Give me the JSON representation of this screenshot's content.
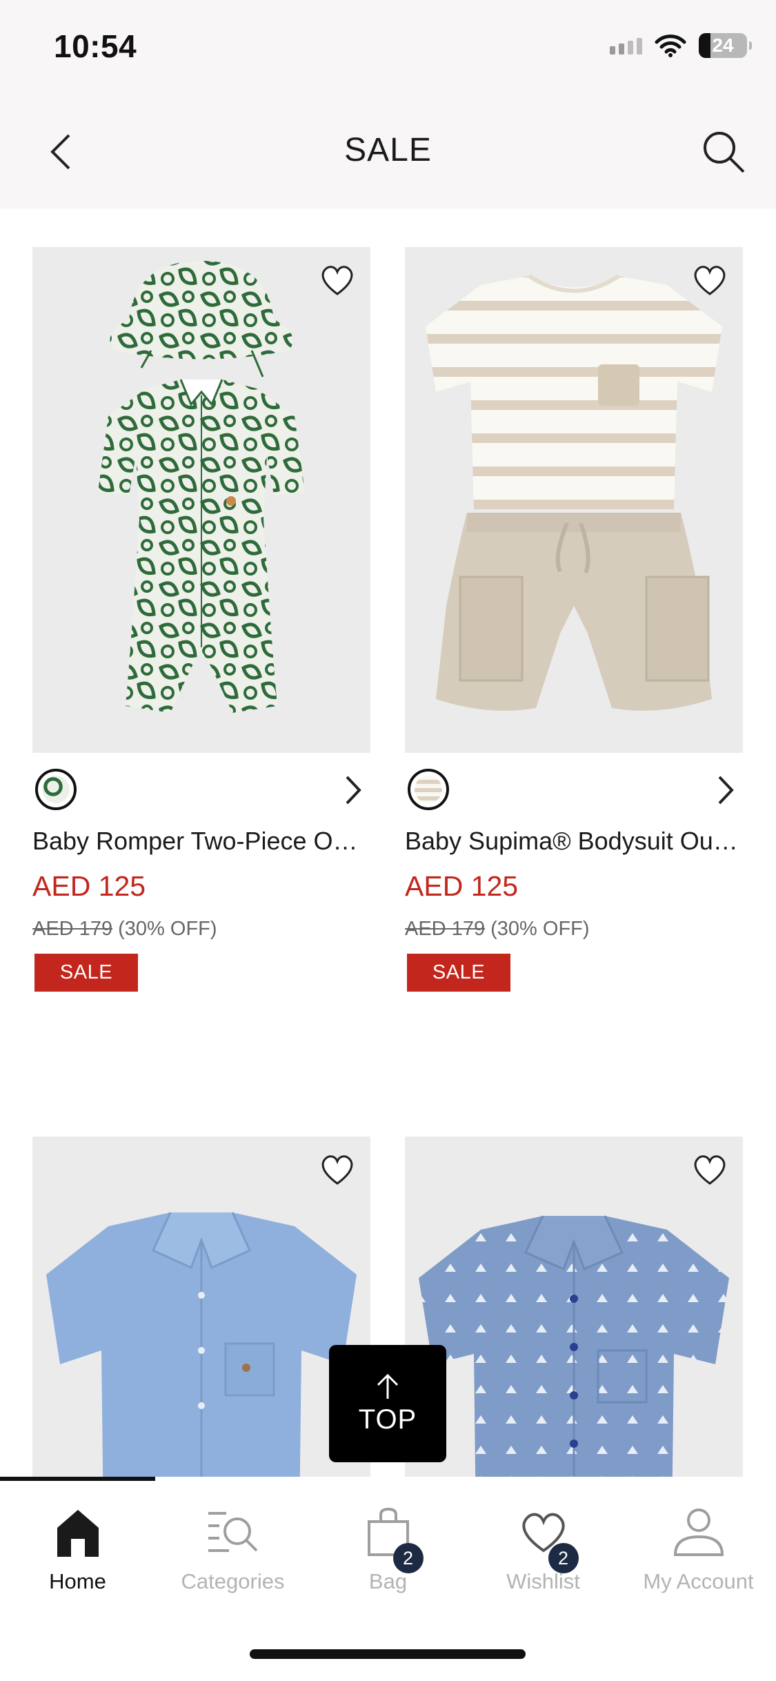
{
  "status_bar": {
    "time": "10:54",
    "battery": "24"
  },
  "header": {
    "title": "SALE"
  },
  "products": [
    {
      "name": "Baby Romper Two-Piece Outfit Set",
      "price": "AED 125",
      "was_price": "AED 179",
      "discount": "(30% OFF)",
      "badge": "SALE",
      "swatch_color": "#2f6b3a"
    },
    {
      "name": "Baby Supima® Bodysuit Outfit Set",
      "price": "AED 125",
      "was_price": "AED 179",
      "discount": "(30% OFF)",
      "badge": "SALE",
      "swatch_color": "#d8cfc0"
    },
    {
      "name": "",
      "price": "",
      "was_price": "",
      "discount": "",
      "badge": ""
    },
    {
      "name": "",
      "price": "",
      "was_price": "",
      "discount": "",
      "badge": ""
    }
  ],
  "top_button": {
    "label": "TOP"
  },
  "tab_bar": {
    "tabs": [
      {
        "label": "Home",
        "icon": "home-icon"
      },
      {
        "label": "Categories",
        "icon": "categories-icon"
      },
      {
        "label": "Bag",
        "icon": "bag-icon",
        "count": "2"
      },
      {
        "label": "Wishlist",
        "icon": "heart-icon",
        "count": "2"
      },
      {
        "label": "My Account",
        "icon": "account-icon"
      }
    ]
  },
  "colors": {
    "sale_red": "#c2261d",
    "badge_navy": "#1d2a44",
    "image_bg": "#ebebeb"
  }
}
